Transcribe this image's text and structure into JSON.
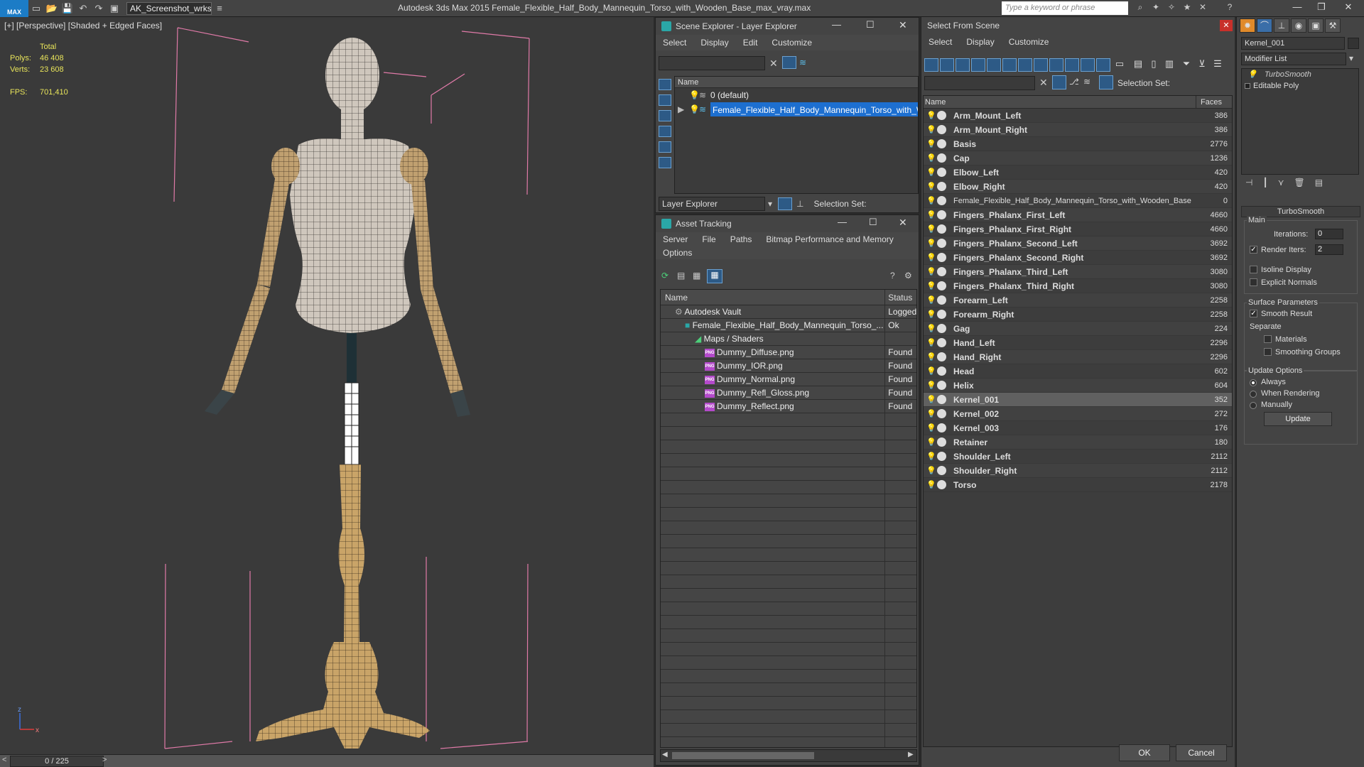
{
  "titlebar": {
    "logo": "MAX",
    "workspace": "AK_Screenshot_wrksp",
    "app_title": "Autodesk 3ds Max  2015    Female_Flexible_Half_Body_Mannequin_Torso_with_Wooden_Base_max_vray.max",
    "search_placeholder": "Type a keyword or phrase"
  },
  "viewport": {
    "label": "[+] [Perspective] [Shaded + Edged Faces]",
    "stats": {
      "total_label": "Total",
      "polys_label": "Polys:",
      "polys": "46 408",
      "verts_label": "Verts:",
      "verts": "23 608",
      "fps_label": "FPS:",
      "fps": "701,410"
    },
    "axis_z": "z",
    "axis_x": "x"
  },
  "timeslider": {
    "value": "0 / 225",
    "prev": "<",
    "next": ">"
  },
  "scene_explorer": {
    "title": "Scene Explorer - Layer Explorer",
    "menu": [
      "Select",
      "Display",
      "Edit",
      "Customize"
    ],
    "col_name": "Name",
    "layers": [
      "0 (default)",
      "Female_Flexible_Half_Body_Mannequin_Torso_with_Woo..."
    ],
    "bottom_dropdown": "Layer Explorer",
    "selection_set_label": "Selection Set:"
  },
  "asset_tracking": {
    "title": "Asset Tracking",
    "menu1": [
      "Server",
      "File",
      "Paths",
      "Bitmap Performance and Memory"
    ],
    "menu2": [
      "Options"
    ],
    "col_name": "Name",
    "col_status": "Status",
    "rows": [
      {
        "name": "Autodesk Vault",
        "status": "Logged"
      },
      {
        "name": "Female_Flexible_Half_Body_Mannequin_Torso_...",
        "status": "Ok"
      },
      {
        "name": "Maps / Shaders",
        "status": ""
      },
      {
        "name": "Dummy_Diffuse.png",
        "status": "Found"
      },
      {
        "name": "Dummy_IOR.png",
        "status": "Found"
      },
      {
        "name": "Dummy_Normal.png",
        "status": "Found"
      },
      {
        "name": "Dummy_Refl_Gloss.png",
        "status": "Found"
      },
      {
        "name": "Dummy_Reflect.png",
        "status": "Found"
      }
    ],
    "png_badge": "PNG"
  },
  "select_from_scene": {
    "title": "Select From Scene",
    "menu": [
      "Select",
      "Display",
      "Customize"
    ],
    "selection_set_label": "Selection Set:",
    "col_name": "Name",
    "col_faces": "Faces",
    "objects": [
      {
        "name": "Arm_Mount_Left",
        "faces": "386"
      },
      {
        "name": "Arm_Mount_Right",
        "faces": "386"
      },
      {
        "name": "Basis",
        "faces": "2776"
      },
      {
        "name": "Cap",
        "faces": "1236"
      },
      {
        "name": "Elbow_Left",
        "faces": "420"
      },
      {
        "name": "Elbow_Right",
        "faces": "420"
      },
      {
        "name": "Female_Flexible_Half_Body_Mannequin_Torso_with_Wooden_Base",
        "faces": "0"
      },
      {
        "name": "Fingers_Phalanx_First_Left",
        "faces": "4660"
      },
      {
        "name": "Fingers_Phalanx_First_Right",
        "faces": "4660"
      },
      {
        "name": "Fingers_Phalanx_Second_Left",
        "faces": "3692"
      },
      {
        "name": "Fingers_Phalanx_Second_Right",
        "faces": "3692"
      },
      {
        "name": "Fingers_Phalanx_Third_Left",
        "faces": "3080"
      },
      {
        "name": "Fingers_Phalanx_Third_Right",
        "faces": "3080"
      },
      {
        "name": "Forearm_Left",
        "faces": "2258"
      },
      {
        "name": "Forearm_Right",
        "faces": "2258"
      },
      {
        "name": "Gag",
        "faces": "224"
      },
      {
        "name": "Hand_Left",
        "faces": "2296"
      },
      {
        "name": "Hand_Right",
        "faces": "2296"
      },
      {
        "name": "Head",
        "faces": "602"
      },
      {
        "name": "Helix",
        "faces": "604"
      },
      {
        "name": "Kernel_001",
        "faces": "352"
      },
      {
        "name": "Kernel_002",
        "faces": "272"
      },
      {
        "name": "Kernel_003",
        "faces": "176"
      },
      {
        "name": "Retainer",
        "faces": "180"
      },
      {
        "name": "Shoulder_Left",
        "faces": "2112"
      },
      {
        "name": "Shoulder_Right",
        "faces": "2112"
      },
      {
        "name": "Torso",
        "faces": "2178"
      }
    ],
    "ok": "OK",
    "cancel": "Cancel"
  },
  "command_panel": {
    "object_name": "Kernel_001",
    "modifier_list": "Modifier List",
    "stack": [
      "TurboSmooth",
      "Editable Poly"
    ],
    "rollout_title": "TurboSmooth",
    "main_label": "Main",
    "iterations_label": "Iterations:",
    "iterations": "0",
    "render_iters_label": "Render Iters:",
    "render_iters": "2",
    "isoline_label": "Isoline Display",
    "explicit_normals_label": "Explicit Normals",
    "surface_params_label": "Surface Parameters",
    "smooth_result_label": "Smooth Result",
    "separate_label": "Separate",
    "materials_label": "Materials",
    "smoothing_groups_label": "Smoothing Groups",
    "update_options_label": "Update Options",
    "always_label": "Always",
    "when_rendering_label": "When Rendering",
    "manually_label": "Manually",
    "update_button": "Update",
    "check_mark": "✓"
  }
}
